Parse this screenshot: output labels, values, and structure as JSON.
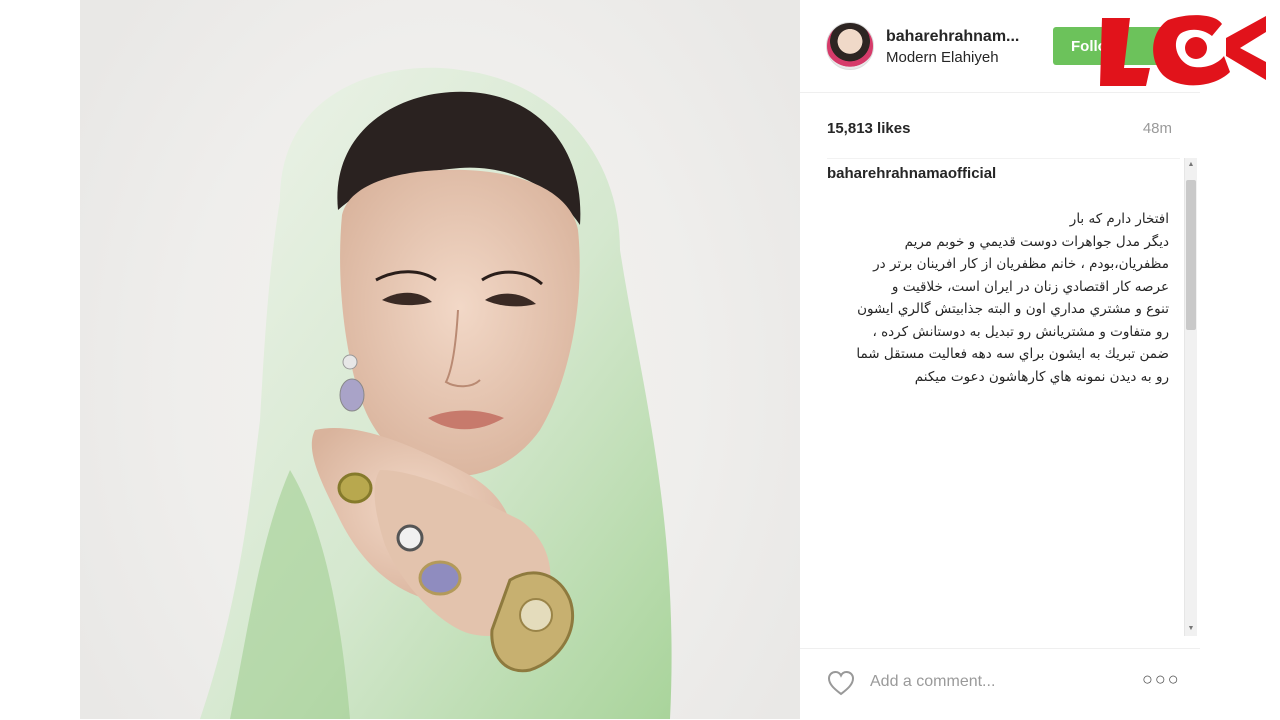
{
  "post": {
    "username": "baharehrahnam...",
    "location": "Modern Elahiyeh",
    "follow_label": "Follow",
    "likes": "15,813 likes",
    "time_ago": "48m"
  },
  "caption": {
    "username": "baharehrahnamaofficial",
    "text": "افتخار دارم كه بار\nديگر مدل جواهرات دوست قديمي و خوبم مريم\nمظفريان،بودم ، خانم مظفريان از كار افرينان برتر در\nعرصه كار اقتصادي زنان در ايران است، خلاقيت و\nتنوع و مشتري مداري اون و البته جذابيتش گالري ايشون\nرو متفاوت و مشتريانش رو تبديل به دوستانش كرده ،\nضمن تبريك به ايشون براي سه دهه فعاليت مستقل شما\nرو به ديدن نمونه هاي كارهاشون دعوت ميكنم"
  },
  "comment": {
    "placeholder": "Add a comment..."
  },
  "icons": {
    "like": "heart-icon",
    "more": "more-options-icon",
    "logo": "news-logo"
  },
  "colors": {
    "follow_button": "#6cc25b",
    "logo_red": "#e1131b"
  }
}
